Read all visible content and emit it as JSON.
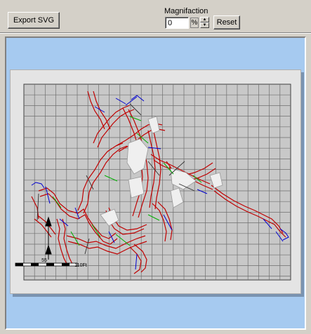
{
  "toolbar": {
    "export_label": "Export SVG",
    "magnification_label": "Magnifaction",
    "magnification_value": "0",
    "percent_symbol": "%",
    "reset_label": "Reset"
  },
  "map": {
    "scale_label_mid": "55",
    "scale_label_end": "110Ft"
  }
}
